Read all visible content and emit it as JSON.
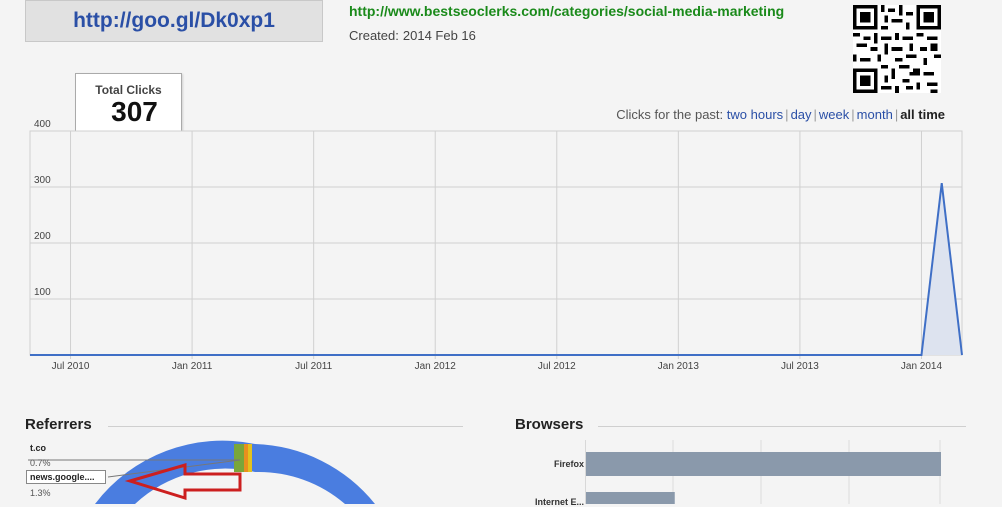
{
  "short_url": "http://goo.gl/Dk0xp1",
  "long_url": "http://www.bestseoclerks.com/categories/social-media-marketing",
  "created": {
    "label": "Created:",
    "date": "2014 Feb 16"
  },
  "total_clicks": {
    "label": "Total Clicks",
    "value": "307"
  },
  "time_range": {
    "prefix": "Clicks for the past:",
    "options": [
      "two hours",
      "day",
      "week",
      "month",
      "all time"
    ],
    "selected": "all time"
  },
  "chart_data": {
    "type": "area",
    "x_ticks": [
      "Jul 2010",
      "Jan 2011",
      "Jul 2011",
      "Jan 2012",
      "Jul 2012",
      "Jan 2013",
      "Jul 2013",
      "Jan 2014"
    ],
    "y_ticks": [
      "100",
      "200",
      "300",
      "400"
    ],
    "ylim": [
      0,
      400
    ],
    "xlim": [
      "2010-05",
      "2014-03"
    ],
    "series": [
      {
        "values": [
          {
            "x": "2010-05",
            "y": 0
          },
          {
            "x": "2014-01",
            "y": 0
          },
          {
            "x": "2014-02",
            "y": 307
          },
          {
            "x": "2014-03",
            "y": 0
          }
        ]
      }
    ],
    "colors": {
      "line": "#3f6fc6",
      "fill": "#dde3ef"
    },
    "grid": true
  },
  "referrers": {
    "title": "Referrers",
    "items": [
      {
        "label": "t.co",
        "pct": "0.7%"
      },
      {
        "label": "news.google....",
        "pct": "1.3%"
      }
    ]
  },
  "browsers": {
    "title": "Browsers",
    "items": [
      {
        "label": "Firefox",
        "value": 1.0
      },
      {
        "label": "Internet E...",
        "value": 0.25
      }
    ],
    "bar_color": "#8a99ab"
  },
  "colors": {
    "link": "#2a4fa6",
    "long_url": "#1a8a1a",
    "arrow": "#cc1f1f",
    "donut": "#4a7de0"
  }
}
